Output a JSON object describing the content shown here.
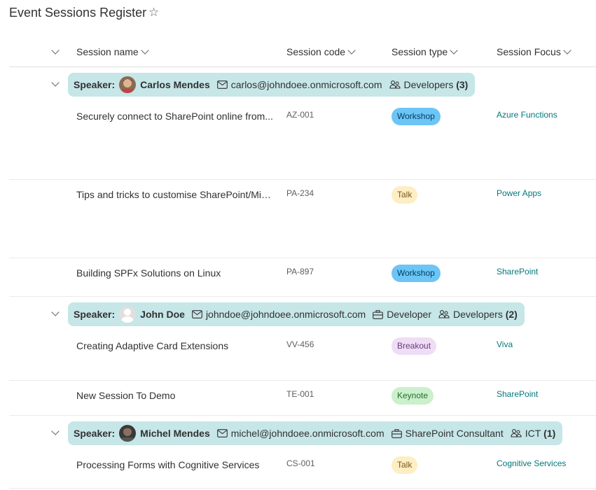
{
  "page": {
    "title": "Event Sessions Register"
  },
  "columns": {
    "name": "Session name",
    "code": "Session code",
    "type": "Session type",
    "focus": "Session Focus"
  },
  "groups": [
    {
      "label": "Speaker:",
      "speaker": "Carlos Mendes",
      "email": "carlos@johndoee.onmicrosoft.com",
      "role": "",
      "team": "Developers",
      "count": "(3)",
      "sessions": [
        {
          "name": "Securely connect to SharePoint online from...",
          "code": "AZ-001",
          "type": "Workshop",
          "type_color": "#6cc5f5",
          "focus": "Azure Functions"
        },
        {
          "name": "Tips and tricks to customise SharePoint/Mic...",
          "code": "PA-234",
          "type": "Talk",
          "type_color": "#fdeec3",
          "focus": "Power Apps"
        },
        {
          "name": "Building SPFx Solutions on Linux",
          "code": "PA-897",
          "type": "Workshop",
          "type_color": "#6cc5f5",
          "focus": "SharePoint"
        }
      ]
    },
    {
      "label": "Speaker:",
      "speaker": "John Doe",
      "email": "johndoe@johndoee.onmicrosoft.com",
      "role": "Developer",
      "team": "Developers",
      "count": "(2)",
      "sessions": [
        {
          "name": "Creating Adaptive Card Extensions",
          "code": "VV-456",
          "type": "Breakout",
          "type_color": "#eeddf4",
          "focus": "Viva"
        },
        {
          "name": "New Session To Demo",
          "code": "TE-001",
          "type": "Keynote",
          "type_color": "#caf0cc",
          "focus": "SharePoint"
        }
      ]
    },
    {
      "label": "Speaker:",
      "speaker": "Michel Mendes",
      "email": "michel@johndoee.onmicrosoft.com",
      "role": "SharePoint Consultant",
      "team": "ICT",
      "count": "(1)",
      "sessions": [
        {
          "name": "Processing Forms with Cognitive Services",
          "code": "CS-001",
          "type": "Talk",
          "type_color": "#fdeec3",
          "focus": "Cognitive Services"
        }
      ]
    }
  ],
  "icons": {
    "favorite": "star-outline-icon",
    "email": "mail-icon",
    "role": "briefcase-icon",
    "team": "people-team-icon",
    "collapse": "chevron-down-icon"
  }
}
